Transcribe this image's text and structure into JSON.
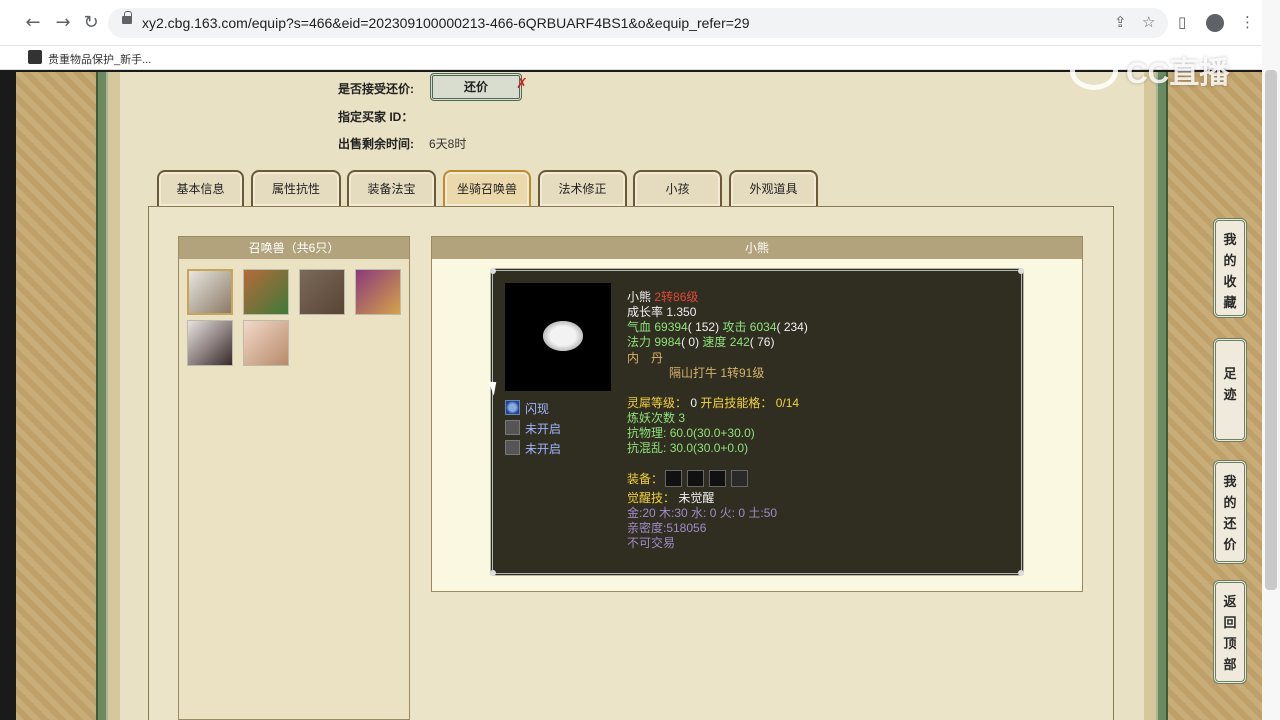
{
  "browser": {
    "back_glyph": "←",
    "forward_glyph": "→",
    "reload_glyph": "↻",
    "url": "xy2.cbg.163.com/equip?s=466&eid=202309100000213-466-6QRBUARF4BS1&o&equip_refer=29",
    "share_glyph": "⇪",
    "star_glyph": "☆",
    "sidebar_glyph": "▯",
    "menu_glyph": "⋮",
    "bookmark_label": "贵重物品保护_新手..."
  },
  "watermark": {
    "text": "CC直播"
  },
  "sale_info": {
    "counter_offer_label": "是否接受还价:",
    "counter_offer_button": "还价",
    "counter_offer_mark": "✗",
    "buyer_id_label": "指定买家 ID：",
    "time_left_label": "出售剩余时间:",
    "time_left_value": "6天8时"
  },
  "tabs": [
    {
      "label": "基本信息",
      "active": false
    },
    {
      "label": "属性抗性",
      "active": false
    },
    {
      "label": "装备法宝",
      "active": false
    },
    {
      "label": "坐骑召唤兽",
      "active": true
    },
    {
      "label": "法术修正",
      "active": false
    },
    {
      "label": "小孩",
      "active": false
    },
    {
      "label": "外观道具",
      "active": false
    }
  ],
  "pets_panel": {
    "title": "召唤兽（共6只）",
    "count": 6
  },
  "pet_detail": {
    "title": "小熊",
    "name": "小熊",
    "level": "2转86级",
    "growth_label": "成长率",
    "growth_value": "1.350",
    "hp_label": "气血",
    "hp_value": "69394",
    "hp_extra": "( 152)",
    "atk_label": "攻击",
    "atk_value": "6034",
    "atk_extra": "( 234)",
    "mp_label": "法力",
    "mp_value": "9984",
    "mp_extra": "( 0)",
    "spd_label": "速度",
    "spd_value": "242",
    "spd_extra": "( 76)",
    "neidan_label": "内　丹",
    "neidan_value": "隔山打牛 1转91级",
    "skills": [
      {
        "name": "闪现",
        "icon": "flash-skill-icon"
      },
      {
        "name": "未开启",
        "icon": "locked-skill-icon"
      },
      {
        "name": "未开启",
        "icon": "locked-skill-icon"
      }
    ],
    "lingxi_label": "灵犀等级：",
    "lingxi_value": "0",
    "slots_label": "开启技能格：",
    "slots_value": "0/14",
    "refine_label": "炼妖次数",
    "refine_value": "3",
    "phys_label": "抗物理:",
    "phys_value": "60.0",
    "phys_detail": "(30.0+30.0)",
    "chaos_label": "抗混乱:",
    "chaos_value": "30.0",
    "chaos_detail": "(30.0+0.0)",
    "equip_label": "装备：",
    "awaken_label": "觉醒技：",
    "awaken_value": "未觉醒",
    "elements": "金:20 木:30 水: 0 火: 0 土:50",
    "intimacy": "亲密度:518056",
    "trade": "不可交易"
  },
  "side_buttons": [
    {
      "chars": [
        "我",
        "的",
        "收",
        "藏"
      ]
    },
    {
      "chars": [
        "足",
        "迹"
      ]
    },
    {
      "chars": [
        "我",
        "的",
        "还",
        "价"
      ]
    },
    {
      "chars": [
        "返",
        "回",
        "顶",
        "部"
      ]
    }
  ]
}
